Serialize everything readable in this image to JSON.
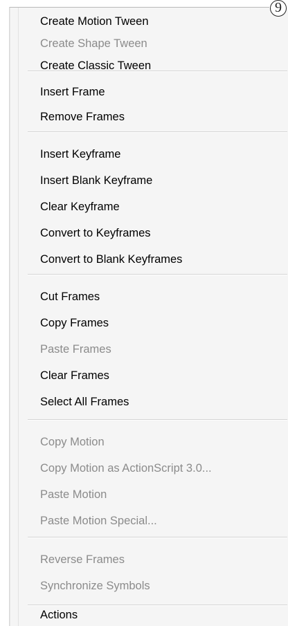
{
  "callout_number": "9",
  "menu": {
    "items": [
      {
        "label": "Create Motion Tween",
        "enabled": true
      },
      {
        "label": "Create Shape Tween",
        "enabled": false
      },
      {
        "label": "Create Classic Tween",
        "enabled": true
      },
      {
        "label": "Insert Frame",
        "enabled": true
      },
      {
        "label": "Remove Frames",
        "enabled": true
      },
      {
        "label": "Insert Keyframe",
        "enabled": true
      },
      {
        "label": "Insert Blank Keyframe",
        "enabled": true
      },
      {
        "label": "Clear Keyframe",
        "enabled": true
      },
      {
        "label": "Convert to Keyframes",
        "enabled": true
      },
      {
        "label": "Convert to Blank Keyframes",
        "enabled": true
      },
      {
        "label": "Cut Frames",
        "enabled": true
      },
      {
        "label": "Copy Frames",
        "enabled": true
      },
      {
        "label": "Paste Frames",
        "enabled": false
      },
      {
        "label": "Clear Frames",
        "enabled": true
      },
      {
        "label": "Select All Frames",
        "enabled": true
      },
      {
        "label": "Copy Motion",
        "enabled": false
      },
      {
        "label": "Copy Motion as ActionScript 3.0...",
        "enabled": false
      },
      {
        "label": "Paste Motion",
        "enabled": false
      },
      {
        "label": "Paste Motion Special...",
        "enabled": false
      },
      {
        "label": "Reverse Frames",
        "enabled": false
      },
      {
        "label": "Synchronize Symbols",
        "enabled": false
      },
      {
        "label": "Actions",
        "enabled": true
      }
    ]
  },
  "colors": {
    "enabled_text": "#000000",
    "disabled_text": "#8b8b8b",
    "menu_background": "#f5f5f5"
  }
}
